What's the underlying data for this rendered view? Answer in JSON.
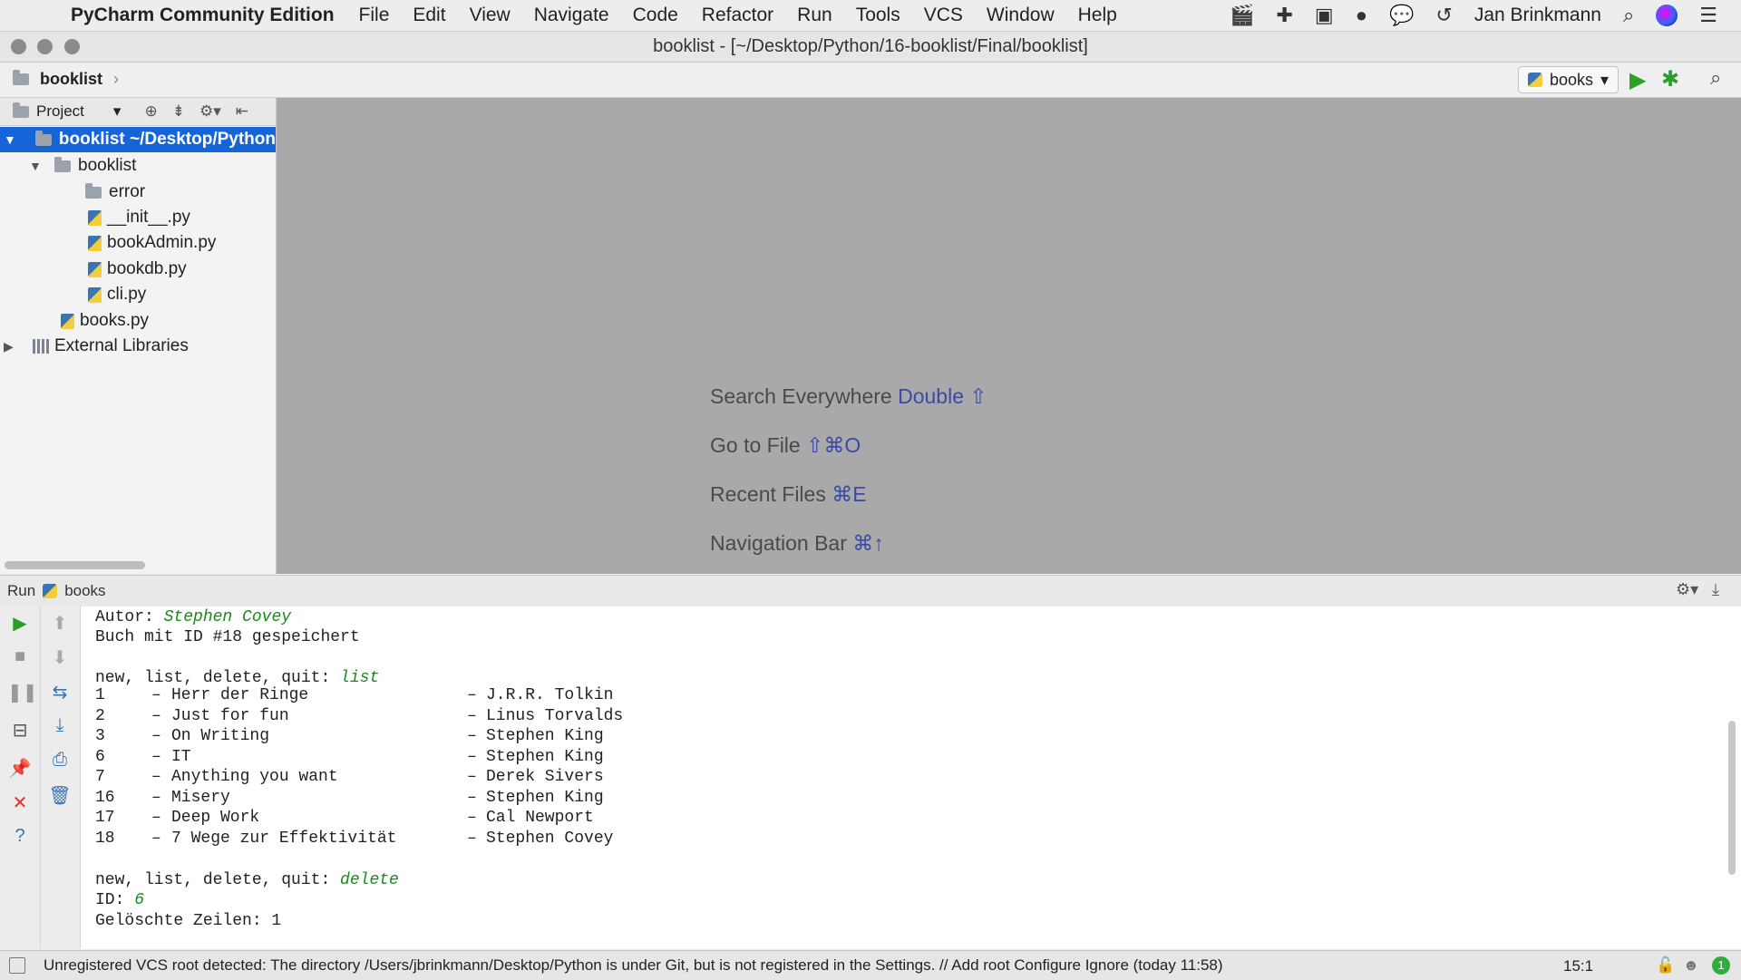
{
  "menubar": {
    "app_name": "PyCharm Community Edition",
    "items": [
      "File",
      "Edit",
      "View",
      "Navigate",
      "Code",
      "Refactor",
      "Run",
      "Tools",
      "VCS",
      "Window",
      "Help"
    ],
    "user": "Jan Brinkmann"
  },
  "window": {
    "title": "booklist - [~/Desktop/Python/16-booklist/Final/booklist]"
  },
  "navbar": {
    "breadcrumb": "booklist",
    "run_config": "books"
  },
  "project": {
    "header_label": "Project",
    "root_name": "booklist",
    "root_path": "~/Desktop/Python",
    "folder_booklist": "booklist",
    "folder_error": "error",
    "files_inner": [
      "__init__.py",
      "bookAdmin.py",
      "bookdb.py",
      "cli.py"
    ],
    "file_books": "books.py",
    "external_libraries": "External Libraries"
  },
  "editor_hints": [
    {
      "label": "Search Everywhere",
      "shortcut": "Double ⇧"
    },
    {
      "label": "Go to File",
      "shortcut": "⇧⌘O"
    },
    {
      "label": "Recent Files",
      "shortcut": "⌘E"
    },
    {
      "label": "Navigation Bar",
      "shortcut": "⌘↑"
    }
  ],
  "run_panel": {
    "label": "Run",
    "config": "books"
  },
  "console": {
    "autor_prefix": "Autor: ",
    "autor_value": "Stephen Covey",
    "saved_msg": "Buch mit ID #18 gespeichert",
    "prompt": "new, list, delete, quit: ",
    "input_list": "list",
    "books": [
      {
        "id": "1",
        "title": "Herr der Ringe",
        "author": "J.R.R. Tolkin"
      },
      {
        "id": "2",
        "title": "Just for fun",
        "author": "Linus Torvalds"
      },
      {
        "id": "3",
        "title": "On Writing",
        "author": "Stephen King"
      },
      {
        "id": "6",
        "title": "IT",
        "author": "Stephen King"
      },
      {
        "id": "7",
        "title": "Anything you want",
        "author": "Derek Sivers"
      },
      {
        "id": "16",
        "title": "Misery",
        "author": "Stephen King"
      },
      {
        "id": "17",
        "title": "Deep Work",
        "author": "Cal Newport"
      },
      {
        "id": "18",
        "title": "7 Wege zur Effektivität",
        "author": "Stephen Covey"
      }
    ],
    "input_delete": "delete",
    "id_prefix": "ID: ",
    "id_value": "6",
    "deleted_msg": "Gelöschte Zeilen: 1"
  },
  "statusbar": {
    "message": "Unregistered VCS root detected: The directory /Users/jbrinkmann/Desktop/Python is under Git, but is not registered in the Settings. // Add root  Configure  Ignore (today 11:58)",
    "position": "15:1",
    "badge": "1"
  }
}
